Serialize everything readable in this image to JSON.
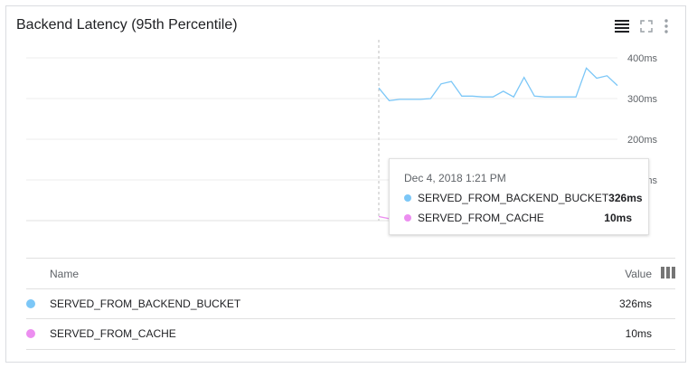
{
  "header": {
    "title": "Backend Latency (95th Percentile)",
    "icons": [
      "legend-toggle-icon",
      "fullscreen-icon",
      "more-vert-icon"
    ]
  },
  "chart_data": {
    "type": "line",
    "title": "Backend Latency (95th Percentile)",
    "y_tick_labels": [
      "400ms",
      "300ms",
      "200ms",
      "100ms"
    ],
    "ylim": [
      0,
      400
    ],
    "y_unit": "ms",
    "grid": true,
    "series": [
      {
        "name": "SERVED_FROM_BACKEND_BUCKET",
        "color": "#7cc7f7",
        "values": [
          326,
          295,
          298,
          298,
          298,
          300,
          336,
          342,
          306,
          306,
          304,
          304,
          318,
          304,
          352,
          306,
          304,
          304,
          304,
          304,
          375,
          350,
          356,
          332
        ]
      },
      {
        "name": "SERVED_FROM_CACHE",
        "color": "#ec8ef0",
        "values": [
          10,
          5,
          5,
          5,
          5,
          5,
          5,
          5,
          5,
          5,
          5,
          5,
          5,
          5,
          5,
          5,
          5,
          5,
          5,
          5,
          5,
          5,
          5,
          5
        ]
      }
    ],
    "hover_index": 0
  },
  "tooltip": {
    "date": "Dec 4, 2018 1:21 PM",
    "rows": [
      {
        "name": "SERVED_FROM_BACKEND_BUCKET",
        "value": "326ms",
        "color": "#7cc7f7"
      },
      {
        "name": "SERVED_FROM_CACHE",
        "value": "10ms",
        "color": "#ec8ef0"
      }
    ]
  },
  "legend": {
    "name_header": "Name",
    "value_header": "Value",
    "rows": [
      {
        "name": "SERVED_FROM_BACKEND_BUCKET",
        "value": "326ms",
        "color": "#7cc7f7"
      },
      {
        "name": "SERVED_FROM_CACHE",
        "value": "10ms",
        "color": "#ec8ef0"
      }
    ]
  }
}
